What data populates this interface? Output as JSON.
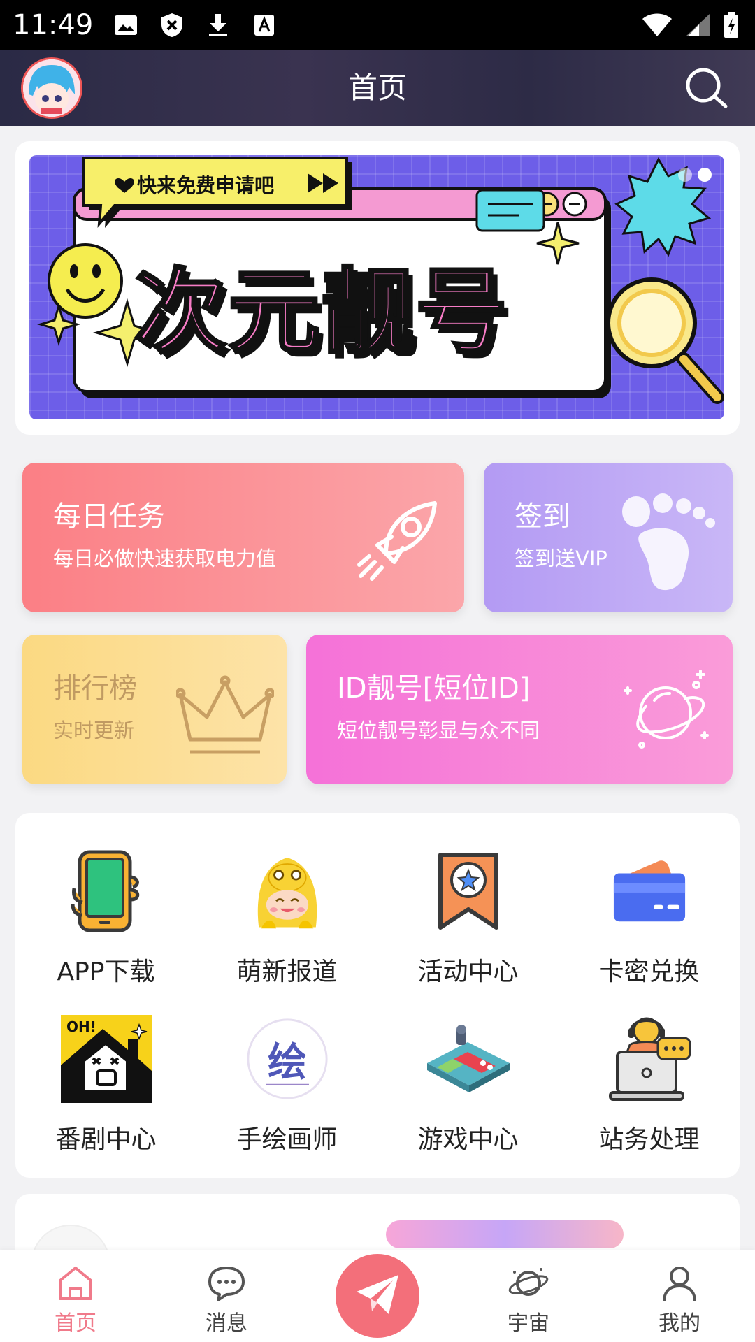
{
  "status_bar": {
    "time": "11:49"
  },
  "app_bar": {
    "title": "首页"
  },
  "banner": {
    "ribbon_text": "快来免费申请吧",
    "headline": "次元靓号"
  },
  "feature_cards": [
    {
      "title": "每日任务",
      "subtitle": "每日必做快速获取电力值",
      "icon": "rocket-icon"
    },
    {
      "title": "签到",
      "subtitle": "签到送VIP",
      "icon": "footprint-icon"
    },
    {
      "title": "排行榜",
      "subtitle": "实时更新",
      "icon": "crown-icon"
    },
    {
      "title": "ID靓号[短位ID]",
      "subtitle": "短位靓号彰显与众不同",
      "icon": "planet-icon"
    }
  ],
  "grid": [
    {
      "label": "APP下载",
      "icon": "phone-icon"
    },
    {
      "label": "萌新报道",
      "icon": "duck-mascot-icon"
    },
    {
      "label": "活动中心",
      "icon": "star-bookmark-icon"
    },
    {
      "label": "卡密兑换",
      "icon": "card-icon"
    },
    {
      "label": "番剧中心",
      "icon": "oh-house-icon"
    },
    {
      "label": "手绘画师",
      "icon": "draw-badge-icon",
      "badge_char": "绘"
    },
    {
      "label": "游戏中心",
      "icon": "gamepad-icon"
    },
    {
      "label": "站务处理",
      "icon": "support-laptop-icon"
    }
  ],
  "tab_bar": [
    {
      "label": "首页",
      "icon": "home-icon",
      "active": true
    },
    {
      "label": "消息",
      "icon": "chat-icon",
      "active": false
    },
    {
      "label": "",
      "icon": "paper-plane-icon",
      "active": false
    },
    {
      "label": "宇宙",
      "icon": "universe-icon",
      "active": false
    },
    {
      "label": "我的",
      "icon": "profile-icon",
      "active": false
    }
  ],
  "colors": {
    "accent": "#f07a8a",
    "fab": "#f36f7a",
    "banner_bg": "#6d5ee8"
  }
}
